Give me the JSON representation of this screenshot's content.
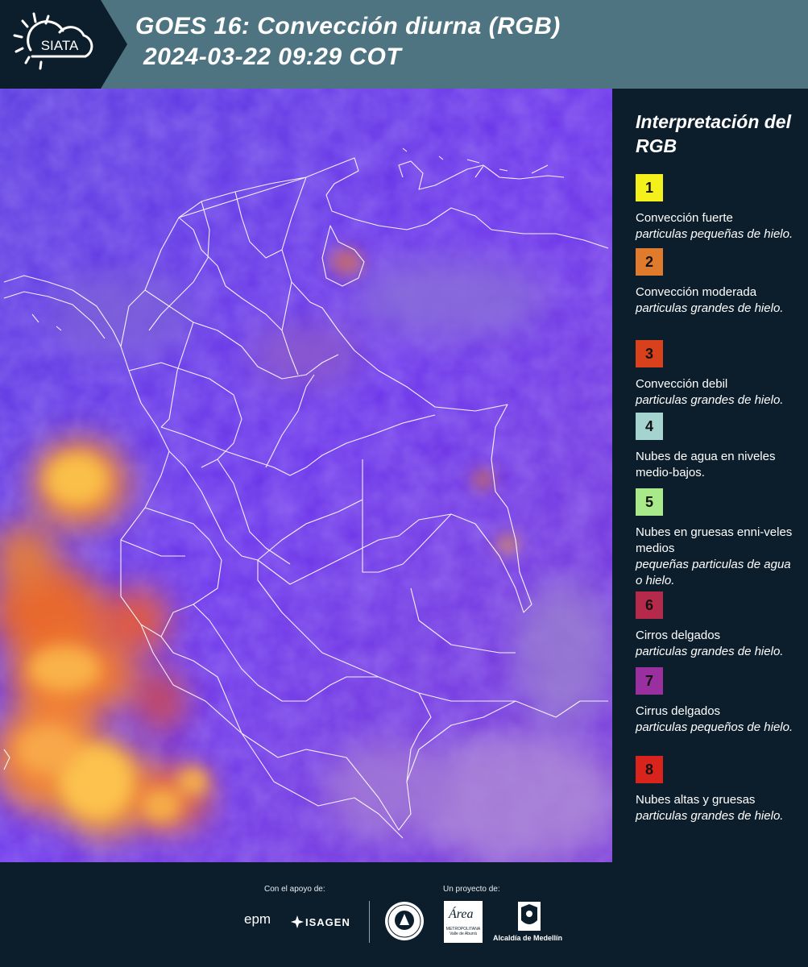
{
  "header": {
    "logo_text": "SIATA",
    "title_line1": "GOES 16: Convección diurna (RGB)",
    "title_line2": "2024-03-22 09:29 COT"
  },
  "legend": {
    "title": "Interpretación del RGB",
    "items": [
      {
        "num": "1",
        "color": "#f4f01c",
        "label": "Convección fuerte",
        "sub": "particulas pequeñas de hielo."
      },
      {
        "num": "2",
        "color": "#e07a2c",
        "label": "Convección moderada",
        "sub": "particulas grandes de hielo."
      },
      {
        "num": "3",
        "color": "#d9401c",
        "label": "Convección debil",
        "sub": "particulas grandes de hielo."
      },
      {
        "num": "4",
        "color": "#a5d3d0",
        "label": "Nubes de agua en niveles medio-bajos.",
        "sub": ""
      },
      {
        "num": "5",
        "color": "#a8ea8a",
        "label": "Nubes en gruesas enni-veles medios",
        "sub": "pequeñas particulas de agua o hielo."
      },
      {
        "num": "6",
        "color": "#b52a4a",
        "label": "Cirros delgados",
        "sub": "particulas grandes de hielo."
      },
      {
        "num": "7",
        "color": "#9a2fa0",
        "label": "Cirrus delgados",
        "sub": "particulas pequeños de hielo."
      },
      {
        "num": "8",
        "color": "#d8241c",
        "label": "Nubes altas y gruesas",
        "sub": "particulas grandes de hielo."
      }
    ]
  },
  "footer": {
    "support_label": "Con el apoyo de:",
    "project_label": "Un proyecto de:",
    "sponsor1": "epm",
    "sponsor2": "ISAGEN",
    "partner_area": "Área",
    "partner_area_sub": "METROPOLITANA Valle de Aburrá",
    "partner_alcaldia": "Alcaldía de Medellín"
  },
  "colors": {
    "header_bg": "#4e7482",
    "page_bg": "#0c1e2b",
    "map_base": "#5b2ee8"
  },
  "icons": [
    "sun-icon",
    "epm-logo",
    "isagen-logo",
    "university-seal",
    "area-metropolitana-logo",
    "alcaldia-logo"
  ]
}
